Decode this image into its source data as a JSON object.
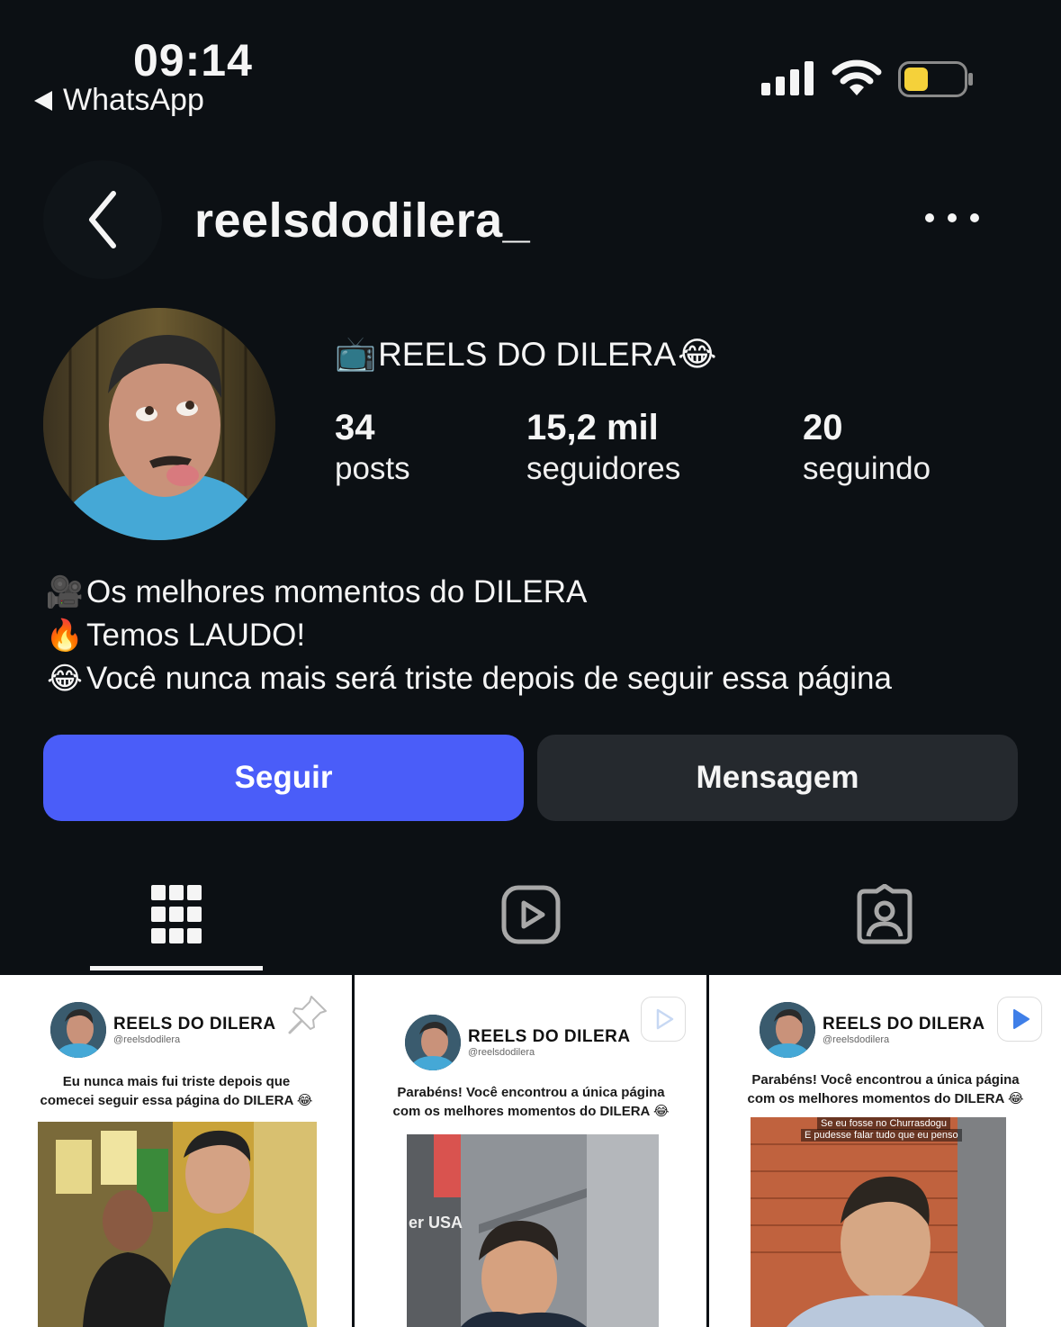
{
  "status_bar": {
    "time": "09:14",
    "back_app": "WhatsApp",
    "battery_color": "#f5d13a"
  },
  "header": {
    "username": "reelsdodilera_",
    "back_icon": "chevron-left-icon",
    "more_icon": "more-horizontal-icon"
  },
  "profile": {
    "display_name": "REELS DO DILERA",
    "display_name_prefix_emoji": "📺",
    "display_name_suffix_emoji": "😂",
    "stats": [
      {
        "value": "34",
        "label": "posts"
      },
      {
        "value": "15,2 mil",
        "label": "seguidores"
      },
      {
        "value": "20",
        "label": "seguindo"
      }
    ],
    "bio": [
      {
        "emoji": "🎥",
        "text": "Os melhores momentos do DILERA"
      },
      {
        "emoji": "🔥",
        "text": "Temos LAUDO!"
      },
      {
        "emoji": "😂",
        "text": "Você nunca mais será triste depois de seguir essa página"
      }
    ]
  },
  "actions": {
    "follow_label": "Seguir",
    "message_label": "Mensagem",
    "follow_color": "#4a5df9",
    "message_color": "#25292e"
  },
  "tabs": [
    {
      "icon": "grid-icon",
      "active": true
    },
    {
      "icon": "reels-icon",
      "active": false
    },
    {
      "icon": "tagged-icon",
      "active": false
    }
  ],
  "posts": [
    {
      "title": "REELS DO DILERA",
      "handle": "@reelsdodilera",
      "caption_line1": "Eu nunca mais fui  triste depois que",
      "caption_line2": "comecei seguir essa página do DILERA 😂",
      "badge_icon": "pin-icon"
    },
    {
      "title": "REELS DO DILERA",
      "handle": "@reelsdodilera",
      "caption_line1": "Parabéns! Você encontrou a única página",
      "caption_line2": "com os melhores momentos do DILERA 😂",
      "badge_icon": "reel-play-icon"
    },
    {
      "title": "REELS DO DILERA",
      "handle": "@reelsdodilera",
      "caption_line1": "Parabéns! Você encontrou a única página",
      "caption_line2": "com os melhores momentos do DILERA 😂",
      "overlay_line1": "Se eu fosse no Churrasdogu",
      "overlay_line2": "E pudesse falar tudo que eu penso",
      "badge_icon": "reel-play-icon"
    }
  ]
}
